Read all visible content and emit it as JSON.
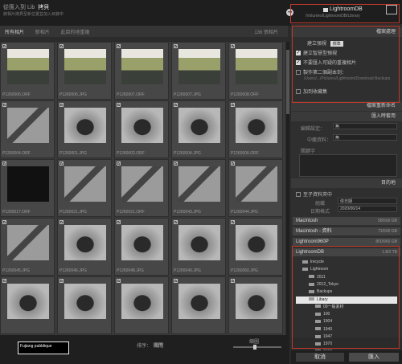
{
  "topbar": {
    "left_mode": "從匯入到 Lib",
    "left_title": "拷貝",
    "left_sub": "將相片拷貝至新位置並加入目錄中",
    "destination": "LightroomDB",
    "destination_path": "/Volumes/LightroomDB/Library"
  },
  "subbar": {
    "tabs": [
      "所有相片",
      "新相片",
      "此目的地重複"
    ],
    "count": "136 張相片"
  },
  "grid": {
    "cells": [
      {
        "label": "P1260006.ORF",
        "kind": "people"
      },
      {
        "label": "P1260006.JPG",
        "kind": "people"
      },
      {
        "label": "P1260007.ORF",
        "kind": "people"
      },
      {
        "label": "P1260007.JPG",
        "kind": "people"
      },
      {
        "label": "P1260008.ORF",
        "kind": "people"
      },
      {
        "label": "P1260004.ORF",
        "kind": "phone"
      },
      {
        "label": "P1260001.JPG",
        "kind": "camera"
      },
      {
        "label": "P1260002.ORF",
        "kind": "camera"
      },
      {
        "label": "P1260004.JPG",
        "kind": "camera"
      },
      {
        "label": "P1260006.ORF",
        "kind": "camera"
      },
      {
        "label": "P1260017.ORF",
        "kind": "dark"
      },
      {
        "label": "P1260021.JPG",
        "kind": "phone"
      },
      {
        "label": "P1260021.ORF",
        "kind": "phone"
      },
      {
        "label": "P1260043.JPG",
        "kind": "phone"
      },
      {
        "label": "P1260044.JPG",
        "kind": "phone"
      },
      {
        "label": "P1260045.JPG",
        "kind": "phone"
      },
      {
        "label": "P1260046.JPG",
        "kind": "camera"
      },
      {
        "label": "P1260048.JPG",
        "kind": "camera"
      },
      {
        "label": "P1260049.JPG",
        "kind": "camera"
      },
      {
        "label": "P1260050.JPG",
        "kind": "camera"
      },
      {
        "label": "",
        "kind": "camera"
      },
      {
        "label": "",
        "kind": "camera"
      },
      {
        "label": "",
        "kind": "camera"
      },
      {
        "label": "",
        "kind": "camera"
      },
      {
        "label": "",
        "kind": "camera"
      }
    ]
  },
  "bottombar": {
    "brand": "Fujiang pubblique",
    "sort_label": "排序：",
    "sort_value": "關閉",
    "thumbs_label": "縮圖"
  },
  "panel": {
    "file_handling": "檔案處理",
    "build_previews_label": "建立預視",
    "build_previews_value": "標準",
    "opt1": "建立智慧型預視",
    "opt2": "不要匯入可疑的重複相片",
    "opt3": "製作第二個副本到：",
    "opt3_path": "/Users/.../Pictures/Lightroom/Download Backups",
    "opt4": "加到收藏集",
    "file_rename": "檔案重新命名",
    "apply_during_import": "匯入時套用",
    "develop_settings_label": "編輯設定：",
    "develop_settings_value": "無",
    "metadata_label": "中繼資料：",
    "metadata_value": "無",
    "keywords_label": "關鍵字",
    "destination_head": "目的地",
    "subfolder_label": "至子資料夾中",
    "organize_label": "組織",
    "organize_value": "依日期",
    "date_format_label": "日期格式",
    "date_format_value": "2020/06/14",
    "drives": [
      {
        "name": "Macintosh",
        "cap": "58/500 GB"
      },
      {
        "name": "Macintosh - 資料",
        "cap": "71/500 GB"
      },
      {
        "name": "Lightroom960P",
        "cap": "800/960 GB"
      },
      {
        "name": "LightroomDB",
        "cap": "1.8/2 TB"
      }
    ],
    "folders": [
      "lrecycle",
      "Lightroom",
      "2011",
      "2012_Tokyo",
      "Backups",
      "Libary",
      "00一般素材",
      "100",
      "1904",
      "1940",
      "1947",
      "1970",
      "2002"
    ]
  },
  "actions": {
    "cancel": "取消",
    "import": "匯入"
  }
}
